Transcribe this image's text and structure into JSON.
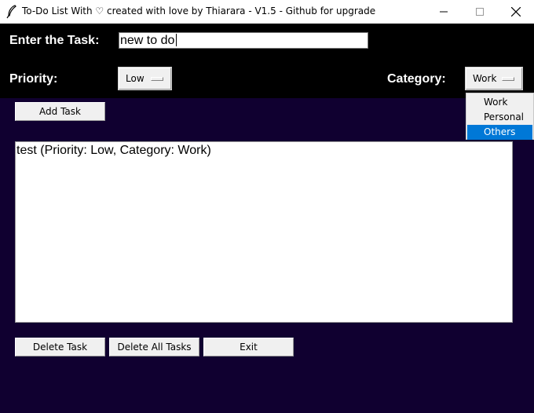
{
  "window": {
    "title": "To-Do List With ♡ created with love by Thiarara - V1.5 - Github for upgrade",
    "minimize_icon": "minimize-icon",
    "maximize_icon": "maximize-icon",
    "close_icon": "close-icon"
  },
  "form": {
    "task_label": "Enter the Task:",
    "task_value": "new to do",
    "priority_label": "Priority:",
    "priority_value": "Low",
    "category_label": "Category:",
    "category_value": "Work"
  },
  "category_dropdown": {
    "options": [
      "Work",
      "Personal",
      "Others"
    ],
    "highlighted": "Others",
    "highlight_color": "#0078d7"
  },
  "buttons": {
    "add_task": "Add Task",
    "delete_task": "Delete Task",
    "delete_all": "Delete All Tasks",
    "exit": "Exit"
  },
  "tasks": [
    "test (Priority: Low, Category: Work)"
  ],
  "colors": {
    "background": "#100030",
    "header": "#000000"
  }
}
